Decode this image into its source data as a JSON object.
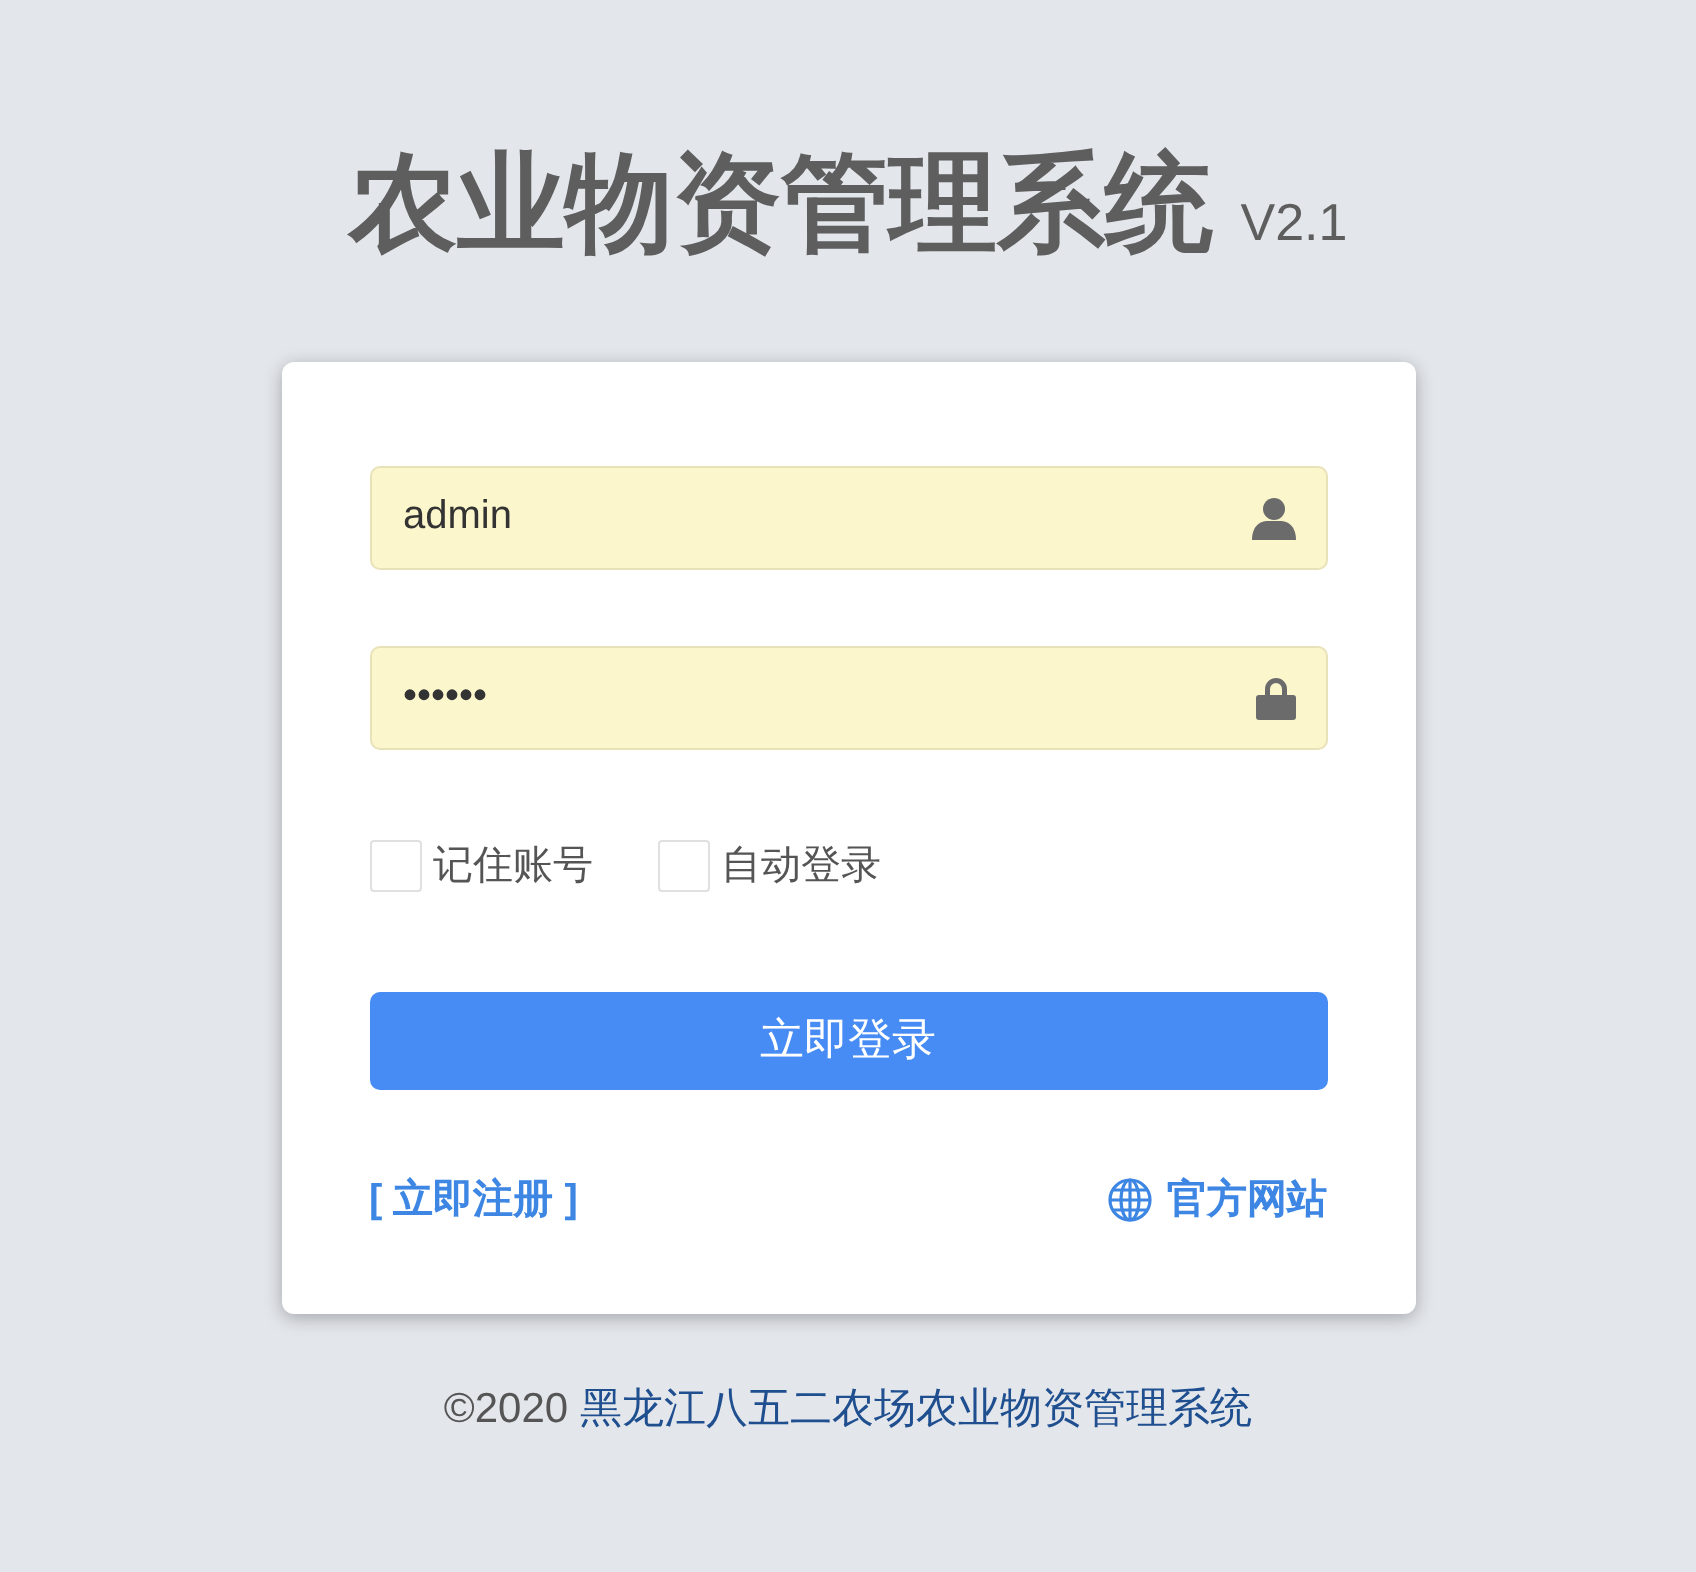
{
  "title": {
    "text": "农业物资管理系统",
    "version": "V2.1"
  },
  "form": {
    "fields": [
      {
        "kind": "username",
        "value": "admin",
        "autofilled": true
      },
      {
        "kind": "password",
        "value": "••••••",
        "autofilled": true
      }
    ],
    "options": [
      {
        "label": "记住账号",
        "checked": false
      },
      {
        "label": "自动登录",
        "checked": false
      }
    ],
    "submit": "立即登录",
    "links": [
      {
        "kind": "register",
        "label": "[ 立即注册 ]"
      },
      {
        "kind": "website",
        "label": "官方网站"
      }
    ]
  },
  "footer": {
    "copyright": "©2020",
    "link": "黑龙江八五二农场农业物资管理系统"
  }
}
